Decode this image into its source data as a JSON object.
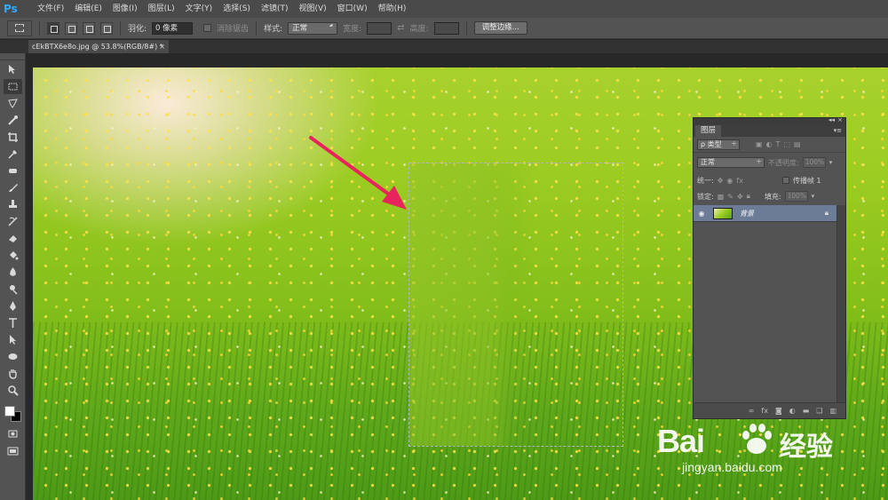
{
  "app": {
    "logo": "Ps",
    "menu": [
      "文件(F)",
      "编辑(E)",
      "图像(I)",
      "图层(L)",
      "文字(Y)",
      "选择(S)",
      "滤镜(T)",
      "视图(V)",
      "窗口(W)",
      "帮助(H)"
    ]
  },
  "options": {
    "feather_label": "羽化:",
    "feather_value": "0 像素",
    "antialias_label": "消除锯齿",
    "style_label": "样式:",
    "style_value": "正常",
    "width_label": "宽度:",
    "height_label": "高度:",
    "refine_button": "调整边缘..."
  },
  "document": {
    "tab_title": "cEkBTX6e8o.jpg @ 53.8%(RGB/8#) *",
    "close": "×"
  },
  "layers_panel": {
    "collapse": "◂◂",
    "close": "×",
    "tab": "图层",
    "menu": "▾≡",
    "filter_select": "ρ 类型",
    "blend_mode": "正常",
    "opacity_label": "不透明度:",
    "opacity_value": "100%",
    "unify_label": "统一:",
    "propagate_label": "传播帧 1",
    "lock_label": "锁定:",
    "fill_label": "填充:",
    "fill_value": "100%",
    "layers": [
      {
        "name": "背景",
        "visible_icon": "eye-icon",
        "locked": true
      }
    ],
    "footer_icons": [
      "link-icon",
      "fx-icon",
      "mask-icon",
      "adjustment-icon",
      "folder-icon",
      "new-layer-icon",
      "trash-icon"
    ]
  },
  "watermark": {
    "logo_text": "Bai",
    "cn_text": "经验",
    "url": "jingyan.baidu.com"
  },
  "colors": {
    "ps_blue": "#31a8ff",
    "foreground": "#ffffff",
    "background": "#000000",
    "arrow": "#e8245c",
    "selected_layer": "#6c7c96"
  }
}
